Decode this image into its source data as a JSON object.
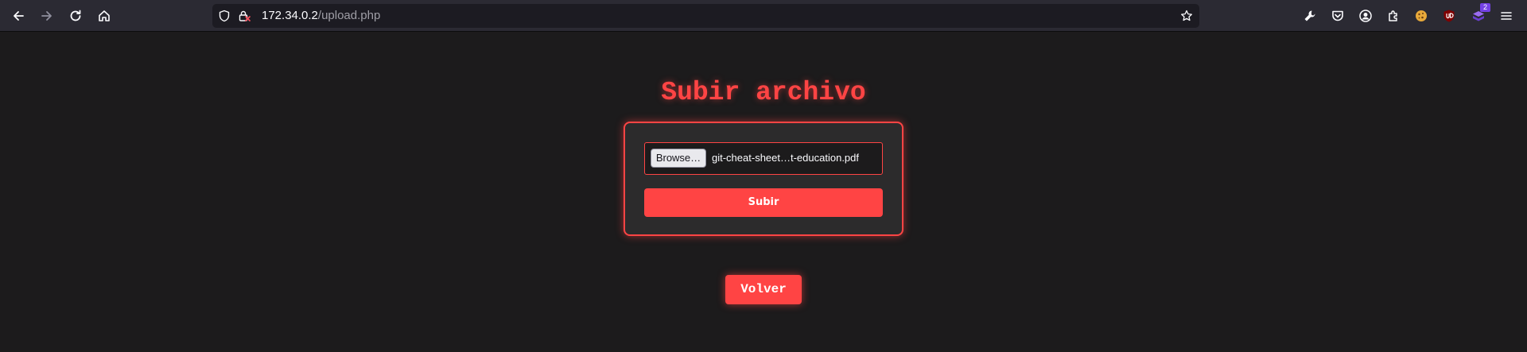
{
  "browser": {
    "url_host": "172.34.0.2",
    "url_path": "/upload.php",
    "extension_badge": "2",
    "icons": {
      "back": "arrow-left-icon",
      "forward": "arrow-right-icon",
      "reload": "reload-icon",
      "home": "home-icon",
      "site_info": "shield-icon",
      "connection": "lock-warning-icon",
      "bookmark": "star-icon",
      "extensions": [
        "wrench-icon",
        "pocket-icon",
        "account-icon",
        "extensions-puzzle-icon",
        "cookie-icon",
        "ublock-icon",
        "stack-extension-icon",
        "menu-icon"
      ]
    }
  },
  "page": {
    "title": "Subir archivo",
    "file_input": {
      "browse_label": "Browse…",
      "file_name": "git-cheat-sheet…t-education.pdf"
    },
    "submit_label": "Subir",
    "back_label": "Volver",
    "colors": {
      "accent": "#ff4444",
      "background": "#1c1b1c",
      "panel": "#2c2b2c"
    }
  }
}
